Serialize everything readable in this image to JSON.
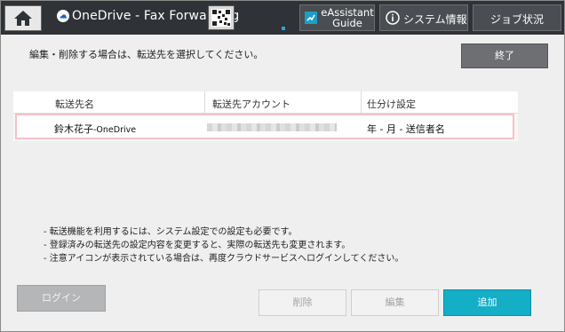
{
  "header": {
    "app_title": "OneDrive - Fax Forwarding",
    "eassistant_line1": "eAssistant",
    "eassistant_line2": "Guide",
    "system_info": "システム情報",
    "job_status": "ジョブ状況",
    "icons": [
      "home-icon",
      "cloud-icon",
      "qr-code-icon",
      "eassistant-icon",
      "info-icon"
    ]
  },
  "main": {
    "instruction": "編集・削除する場合は、転送先を選択してください。",
    "end_button": "終了",
    "table": {
      "headers": [
        "転送先名",
        "転送先アカウント",
        "仕分け設定"
      ],
      "rows": [
        {
          "name_main": "鈴木花子",
          "name_suffix": "-OneDrive",
          "account": "",
          "sort": "年 - 月 - 送信者名"
        }
      ]
    },
    "notes": [
      "- 転送機能を利用するには、システム設定での設定も必要です。",
      "- 登録済みの転送先の設定内容を変更すると、実際の転送先も変更されます。",
      "- 注意アイコンが表示されている場合は、再度クラウドサービスへログインしてください。"
    ]
  },
  "footer": {
    "login": "ログイン",
    "delete": "削除",
    "edit": "編集",
    "add": "追加"
  },
  "colors": {
    "topbar": "#2f3236",
    "accent": "#14aec6",
    "selected_row_border": "#f4c2c6"
  }
}
